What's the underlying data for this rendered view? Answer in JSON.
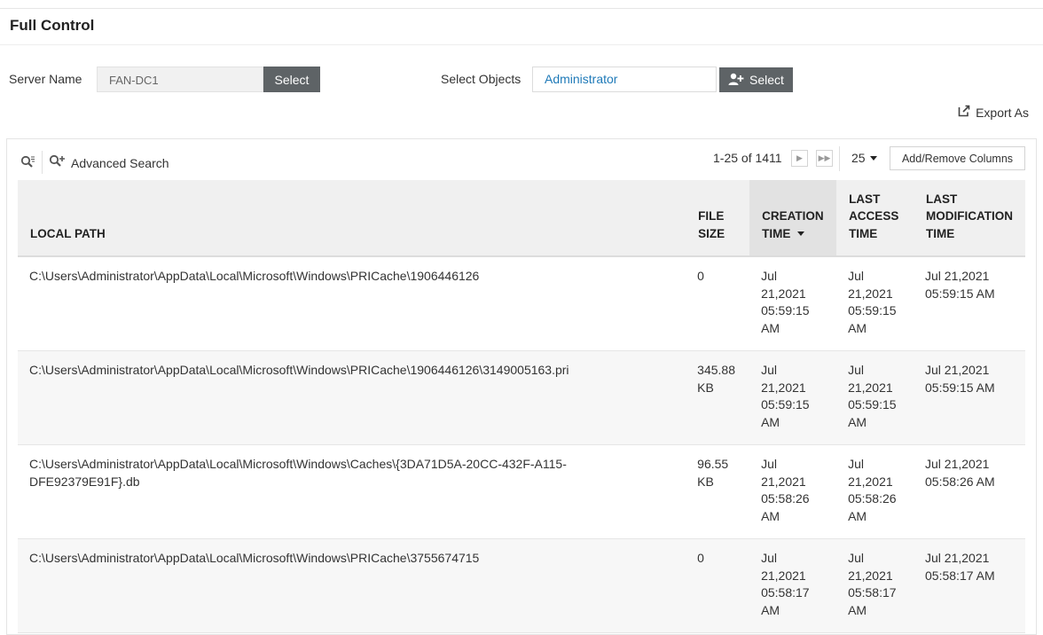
{
  "page": {
    "title": "Full Control"
  },
  "filters": {
    "server_label": "Server Name",
    "server_value": "FAN-DC1",
    "server_select": "Select",
    "objects_label": "Select Objects",
    "objects_value": "Administrator",
    "objects_select": "Select"
  },
  "toolbar": {
    "export_label": "Export As",
    "advanced_search": "Advanced Search",
    "pagination": "1-25 of 1411",
    "per_page": "25",
    "add_remove_columns": "Add/Remove Columns"
  },
  "table": {
    "headers": {
      "local_path": "LOCAL PATH",
      "file_size": "FILE SIZE",
      "creation_time": "CREATION TIME",
      "last_access_time": "LAST ACCESS TIME",
      "last_modification_time": "LAST MODIFICATION TIME"
    },
    "rows": [
      {
        "local_path": "C:\\Users\\Administrator\\AppData\\Local\\Microsoft\\Windows\\PRICache\\1906446126",
        "file_size": "0",
        "creation_time": "Jul 21,2021 05:59:15 AM",
        "last_access_time": "Jul 21,2021 05:59:15 AM",
        "last_modification_time": "Jul 21,2021 05:59:15 AM"
      },
      {
        "local_path": "C:\\Users\\Administrator\\AppData\\Local\\Microsoft\\Windows\\PRICache\\1906446126\\3149005163.pri",
        "file_size": "345.88 KB",
        "creation_time": "Jul 21,2021 05:59:15 AM",
        "last_access_time": "Jul 21,2021 05:59:15 AM",
        "last_modification_time": "Jul 21,2021 05:59:15 AM"
      },
      {
        "local_path": "C:\\Users\\Administrator\\AppData\\Local\\Microsoft\\Windows\\Caches\\{3DA71D5A-20CC-432F-A115-DFE92379E91F}.db",
        "file_size": "96.55 KB",
        "creation_time": "Jul 21,2021 05:58:26 AM",
        "last_access_time": "Jul 21,2021 05:58:26 AM",
        "last_modification_time": "Jul 21,2021 05:58:26 AM"
      },
      {
        "local_path": "C:\\Users\\Administrator\\AppData\\Local\\Microsoft\\Windows\\PRICache\\3755674715",
        "file_size": "0",
        "creation_time": "Jul 21,2021 05:58:17 AM",
        "last_access_time": "Jul 21,2021 05:58:17 AM",
        "last_modification_time": "Jul 21,2021 05:58:17 AM"
      }
    ]
  },
  "colors": {
    "button_bg": "#5e6366",
    "link": "#1f7ab8",
    "header_bg": "#f0f0f0",
    "sorted_header_bg": "#e2e2e2"
  },
  "icons": [
    "search-options-icon",
    "advanced-search-icon",
    "add-user-icon",
    "export-icon",
    "next-page-icon",
    "last-page-icon",
    "dropdown-caret-icon",
    "sort-desc-icon"
  ]
}
